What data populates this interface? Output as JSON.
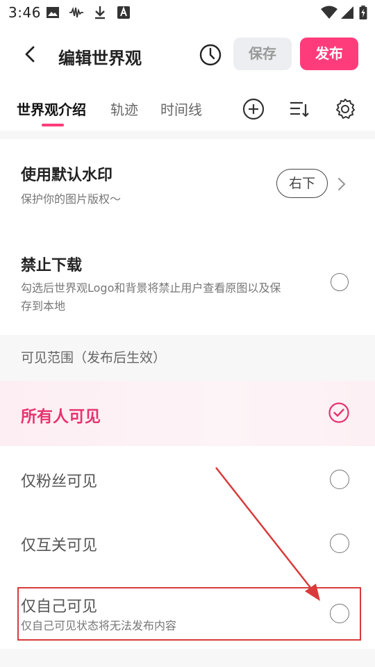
{
  "status_bar": {
    "time": "3:46",
    "icons": [
      "image-icon",
      "audio-wave-icon",
      "download-icon",
      "translate-a-icon",
      "wifi-icon",
      "signal-icon",
      "battery-charging-icon"
    ]
  },
  "header": {
    "title": "编辑世界观",
    "save_label": "保存",
    "publish_label": "发布",
    "icons": [
      "back-arrow-icon",
      "history-clock-icon"
    ]
  },
  "tabs": [
    {
      "label": "世界观介绍",
      "active": true
    },
    {
      "label": "轨迹",
      "active": false
    },
    {
      "label": "时间线",
      "active": false
    }
  ],
  "tab_actions": [
    "add-circle-icon",
    "sort-list-icon",
    "settings-gear-icon"
  ],
  "watermark": {
    "title": "使用默认水印",
    "subtitle": "保护你的图片版权～",
    "position_value": "右下"
  },
  "disable_download": {
    "title": "禁止下载",
    "description_line1": "勾选后世界观Logo和背景将禁止用户查看原图以及保",
    "description_line2": "存到本地",
    "checked": false
  },
  "visibility": {
    "section_label": "可见范围（发布后生效）",
    "options": [
      {
        "label": "所有人可见",
        "selected": true
      },
      {
        "label": "仅粉丝可见",
        "selected": false
      },
      {
        "label": "仅互关可见",
        "selected": false
      },
      {
        "label": "仅自己可见",
        "note": "仅自己可见状态将无法发布内容",
        "selected": false
      }
    ]
  },
  "colors": {
    "accent": "#ff3c7b",
    "selected_text": "#e8336f",
    "annotation": "#d93a3a"
  }
}
